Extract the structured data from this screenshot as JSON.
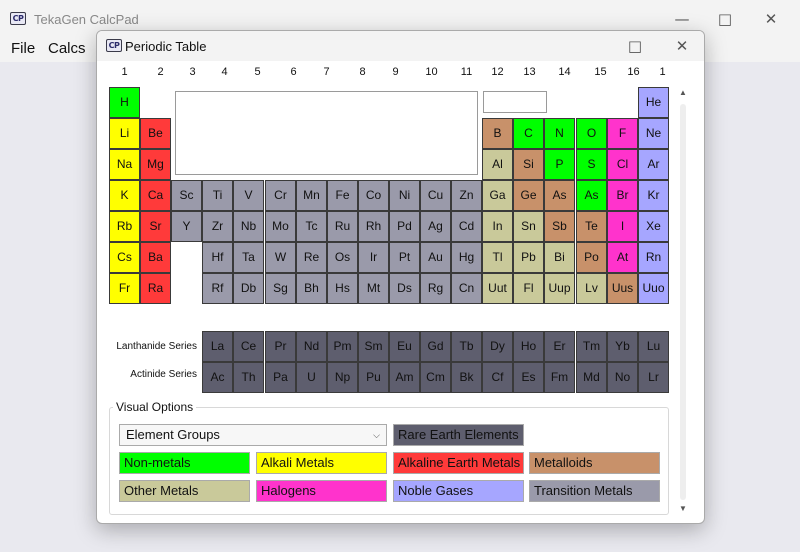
{
  "main_window": {
    "title": "TekaGen CalcPad",
    "icon": "calcpad-app-icon",
    "menu": [
      "File",
      "Calcs"
    ]
  },
  "dialog": {
    "title": "Periodic Table",
    "icon": "calcpad-app-icon"
  },
  "group_numbers": [
    "1",
    "2",
    "3",
    "4",
    "5",
    "6",
    "7",
    "8",
    "9",
    "10",
    "11",
    "12",
    "13",
    "14",
    "15",
    "16",
    "1"
  ],
  "colors": {
    "nonmetal": "#00ff00",
    "alkali": "#ffff00",
    "alkaline": "#ff3a3a",
    "metalloid": "#c8916a",
    "other_metal": "#c9c99a",
    "halogen": "#ff33cc",
    "noble": "#a6a6ff",
    "transition": "#9a9aaa",
    "rare_earth": "#5e5e6e"
  },
  "elements": [
    {
      "s": "H",
      "c": "nonmetal"
    },
    {
      "s": "He",
      "c": "noble"
    },
    {
      "s": "Li",
      "c": "alkali"
    },
    {
      "s": "Be",
      "c": "alkaline"
    },
    {
      "s": "B",
      "c": "metalloid"
    },
    {
      "s": "C",
      "c": "nonmetal"
    },
    {
      "s": "N",
      "c": "nonmetal"
    },
    {
      "s": "O",
      "c": "nonmetal"
    },
    {
      "s": "F",
      "c": "halogen"
    },
    {
      "s": "Ne",
      "c": "noble"
    },
    {
      "s": "Na",
      "c": "alkali"
    },
    {
      "s": "Mg",
      "c": "alkaline"
    },
    {
      "s": "Al",
      "c": "other_metal"
    },
    {
      "s": "Si",
      "c": "metalloid"
    },
    {
      "s": "P",
      "c": "nonmetal"
    },
    {
      "s": "S",
      "c": "nonmetal"
    },
    {
      "s": "Cl",
      "c": "halogen"
    },
    {
      "s": "Ar",
      "c": "noble"
    },
    {
      "s": "K",
      "c": "alkali"
    },
    {
      "s": "Ca",
      "c": "alkaline"
    },
    {
      "s": "Sc",
      "c": "transition"
    },
    {
      "s": "Ti",
      "c": "transition"
    },
    {
      "s": "V",
      "c": "transition"
    },
    {
      "s": "Cr",
      "c": "transition"
    },
    {
      "s": "Mn",
      "c": "transition"
    },
    {
      "s": "Fe",
      "c": "transition"
    },
    {
      "s": "Co",
      "c": "transition"
    },
    {
      "s": "Ni",
      "c": "transition"
    },
    {
      "s": "Cu",
      "c": "transition"
    },
    {
      "s": "Zn",
      "c": "transition"
    },
    {
      "s": "Ga",
      "c": "other_metal"
    },
    {
      "s": "Ge",
      "c": "metalloid"
    },
    {
      "s": "As",
      "c": "metalloid"
    },
    {
      "s": "As",
      "c": "nonmetal"
    },
    {
      "s": "Br",
      "c": "halogen"
    },
    {
      "s": "Kr",
      "c": "noble"
    },
    {
      "s": "Rb",
      "c": "alkali"
    },
    {
      "s": "Sr",
      "c": "alkaline"
    },
    {
      "s": "Y",
      "c": "transition"
    },
    {
      "s": "Zr",
      "c": "transition"
    },
    {
      "s": "Nb",
      "c": "transition"
    },
    {
      "s": "Mo",
      "c": "transition"
    },
    {
      "s": "Tc",
      "c": "transition"
    },
    {
      "s": "Ru",
      "c": "transition"
    },
    {
      "s": "Rh",
      "c": "transition"
    },
    {
      "s": "Pd",
      "c": "transition"
    },
    {
      "s": "Ag",
      "c": "transition"
    },
    {
      "s": "Cd",
      "c": "transition"
    },
    {
      "s": "In",
      "c": "other_metal"
    },
    {
      "s": "Sn",
      "c": "other_metal"
    },
    {
      "s": "Sb",
      "c": "metalloid"
    },
    {
      "s": "Te",
      "c": "metalloid"
    },
    {
      "s": "I",
      "c": "halogen"
    },
    {
      "s": "Xe",
      "c": "noble"
    },
    {
      "s": "Cs",
      "c": "alkali"
    },
    {
      "s": "Ba",
      "c": "alkaline"
    },
    {
      "s": "Hf",
      "c": "transition"
    },
    {
      "s": "Ta",
      "c": "transition"
    },
    {
      "s": "W",
      "c": "transition"
    },
    {
      "s": "Re",
      "c": "transition"
    },
    {
      "s": "Os",
      "c": "transition"
    },
    {
      "s": "Ir",
      "c": "transition"
    },
    {
      "s": "Pt",
      "c": "transition"
    },
    {
      "s": "Au",
      "c": "transition"
    },
    {
      "s": "Hg",
      "c": "transition"
    },
    {
      "s": "Tl",
      "c": "other_metal"
    },
    {
      "s": "Pb",
      "c": "other_metal"
    },
    {
      "s": "Bi",
      "c": "other_metal"
    },
    {
      "s": "Po",
      "c": "metalloid"
    },
    {
      "s": "At",
      "c": "halogen"
    },
    {
      "s": "Rn",
      "c": "noble"
    },
    {
      "s": "Fr",
      "c": "alkali"
    },
    {
      "s": "Ra",
      "c": "alkaline"
    },
    {
      "s": "Rf",
      "c": "transition"
    },
    {
      "s": "Db",
      "c": "transition"
    },
    {
      "s": "Sg",
      "c": "transition"
    },
    {
      "s": "Bh",
      "c": "transition"
    },
    {
      "s": "Hs",
      "c": "transition"
    },
    {
      "s": "Mt",
      "c": "transition"
    },
    {
      "s": "Ds",
      "c": "transition"
    },
    {
      "s": "Rg",
      "c": "transition"
    },
    {
      "s": "Cn",
      "c": "transition"
    },
    {
      "s": "Uut",
      "c": "other_metal"
    },
    {
      "s": "Fl",
      "c": "other_metal"
    },
    {
      "s": "Uup",
      "c": "other_metal"
    },
    {
      "s": "Lv",
      "c": "other_metal"
    },
    {
      "s": "Uus",
      "c": "metalloid"
    },
    {
      "s": "Uuo",
      "c": "noble"
    }
  ],
  "series": {
    "lanthanide_label": "Lanthanide Series",
    "actinide_label": "Actinide Series",
    "lanthanides": [
      "La",
      "Ce",
      "Pr",
      "Nd",
      "Pm",
      "Sm",
      "Eu",
      "Gd",
      "Tb",
      "Dy",
      "Ho",
      "Er",
      "Tm",
      "Yb",
      "Lu"
    ],
    "actinides": [
      "Ac",
      "Th",
      "Pa",
      "U",
      "Np",
      "Pu",
      "Am",
      "Cm",
      "Bk",
      "Cf",
      "Es",
      "Fm",
      "Md",
      "No",
      "Lr"
    ]
  },
  "visual_options": {
    "label": "Visual Options",
    "selected_view": "Element Groups",
    "legend": [
      {
        "label": "Rare Earth Elements",
        "c": "rare_earth"
      },
      {
        "label": "Non-metals",
        "c": "nonmetal"
      },
      {
        "label": "Alkali Metals",
        "c": "alkali"
      },
      {
        "label": "Alkaline Earth Metals",
        "c": "alkaline"
      },
      {
        "label": "Metalloids",
        "c": "metalloid"
      },
      {
        "label": "Other Metals",
        "c": "other_metal"
      },
      {
        "label": "Halogens",
        "c": "halogen"
      },
      {
        "label": "Noble Gases",
        "c": "noble"
      },
      {
        "label": "Transition Metals",
        "c": "transition"
      }
    ]
  }
}
